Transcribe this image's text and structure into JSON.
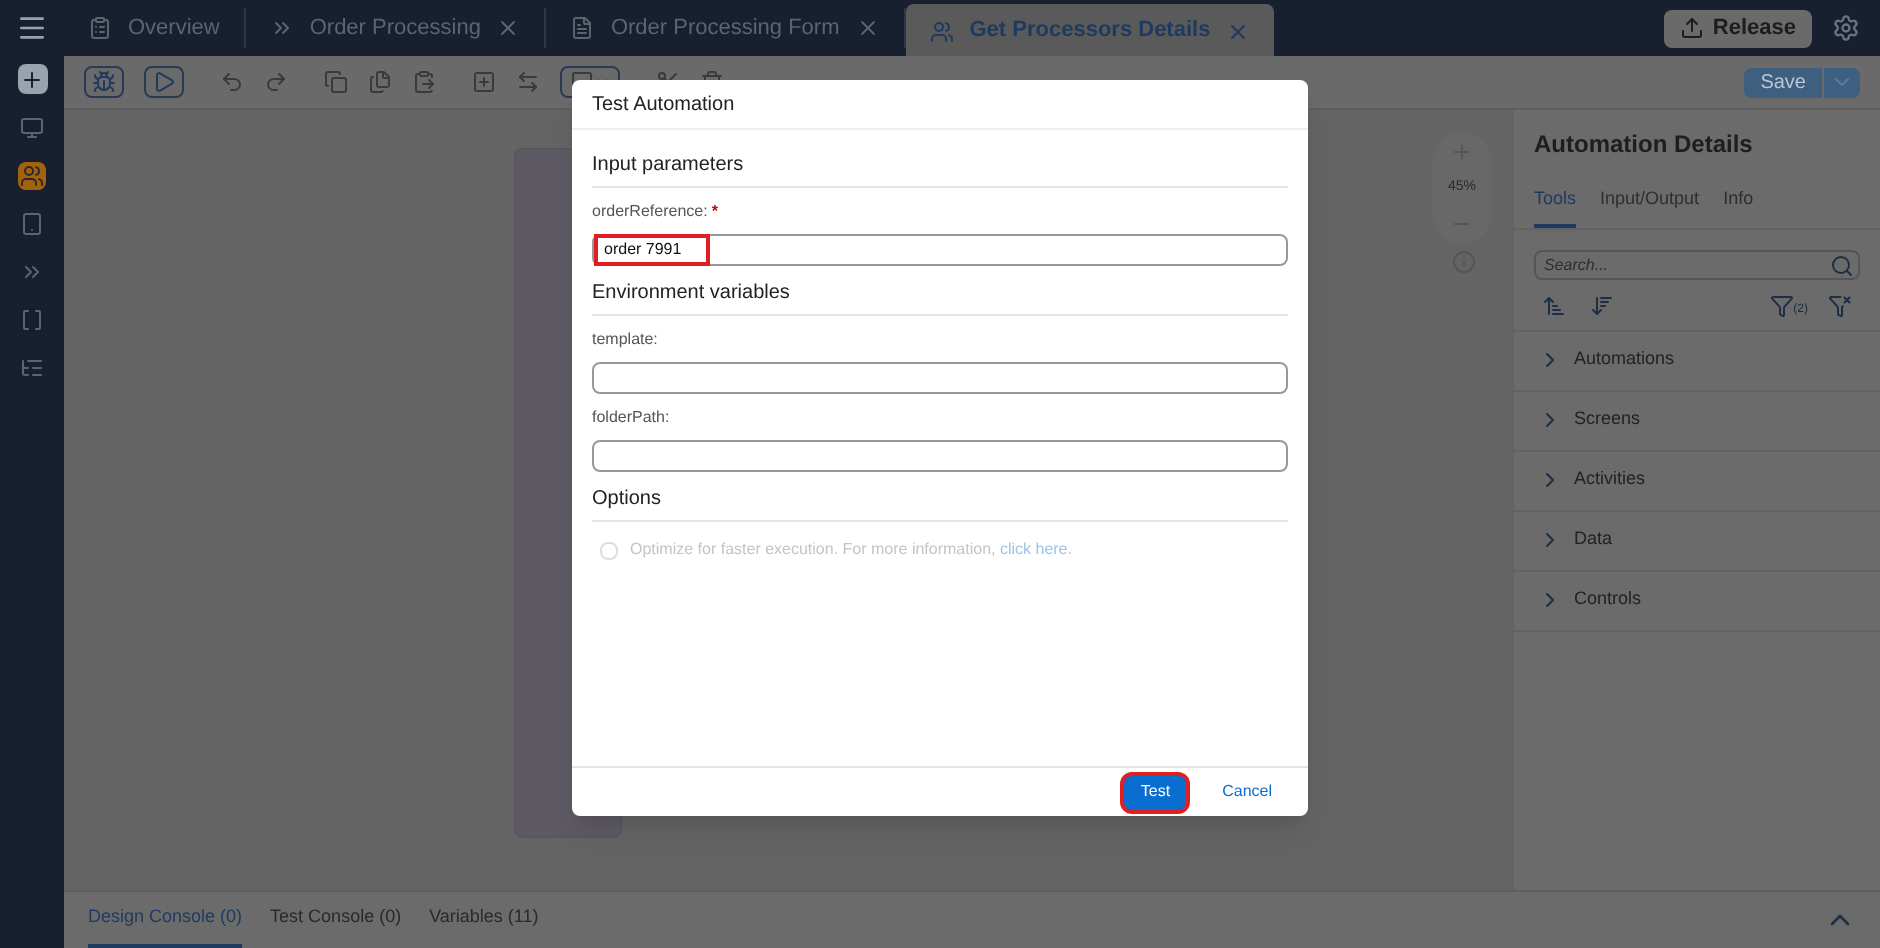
{
  "tabs": [
    {
      "kind": "overview",
      "label": "Overview",
      "selected": false,
      "closable": false
    },
    {
      "kind": "process",
      "label": "Order Processing",
      "selected": false,
      "closable": true
    },
    {
      "kind": "form",
      "label": "Order Processing Form",
      "selected": false,
      "closable": true
    },
    {
      "kind": "automation",
      "label": "Get Processors Details",
      "selected": true,
      "closable": true
    }
  ],
  "release_button": "Release",
  "sidebar": [
    {
      "kind": "monitor",
      "selected": false
    },
    {
      "kind": "automation",
      "selected": true
    },
    {
      "kind": "tablet",
      "selected": false
    },
    {
      "kind": "process",
      "selected": false
    },
    {
      "kind": "brackets",
      "selected": false
    },
    {
      "kind": "list",
      "selected": false
    }
  ],
  "toolbar": {
    "save_button": "Save"
  },
  "canvas": {
    "zoom": "45%"
  },
  "details": {
    "title": "Automation Details",
    "tabs": [
      {
        "label": "Tools",
        "selected": true
      },
      {
        "label": "Input/Output",
        "selected": false
      },
      {
        "label": "Info",
        "selected": false
      }
    ],
    "search": {
      "placeholder": "Search..."
    },
    "filter_count": "(2)",
    "categories": [
      "Automations",
      "Screens",
      "Activities",
      "Data",
      "Controls"
    ]
  },
  "bottom_tabs": [
    {
      "label": "Design Console (0)",
      "selected": true
    },
    {
      "label": "Test Console (0)",
      "selected": false
    },
    {
      "label": "Variables (11)",
      "selected": false
    }
  ],
  "dialog": {
    "title": "Test Automation",
    "sections": [
      {
        "title": "Input parameters",
        "fields": [
          {
            "label": "orderReference:",
            "required_mark": "*",
            "value": "order 7991",
            "highlighted": true
          }
        ]
      },
      {
        "title": "Environment variables",
        "fields": [
          {
            "label": "template:"
          },
          {
            "label": "folderPath:"
          }
        ]
      }
    ],
    "options": {
      "title": "Options",
      "checked": false,
      "disabled": true,
      "text": "Optimize for faster execution. For more information, ",
      "link": "click here."
    },
    "buttons": [
      {
        "kind": "primary",
        "label": "Test",
        "highlighted": true
      },
      {
        "kind": "secondary",
        "label": "Cancel",
        "highlighted": false
      }
    ]
  }
}
